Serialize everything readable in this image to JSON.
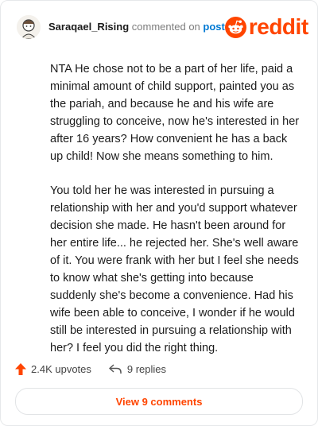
{
  "comment": {
    "username": "Saraqael_Rising",
    "action_text": "commented on",
    "post_link": "post",
    "paragraphs": [
      "NTA He chose not to be a part of her life, paid a minimal amount of child support, painted you as the pariah, and because he and his wife are struggling to conceive, now he's interested in her after 16 years? How convenient he has a back up child! Now she means something to him.",
      "You told her he was interested in pursuing a relationship with her and you'd support whatever decision she made. He hasn't been around for her entire life... he rejected her. She's well aware of it. You were frank with her but I feel she needs to know what she's getting into because suddenly she's become a convenience. Had his wife been able to conceive, I wonder if he would still be interested in pursuing a relationship with her? I feel you did the right thing."
    ]
  },
  "brand": {
    "wordmark": "reddit",
    "color": "#ff4500"
  },
  "footer": {
    "upvotes": "2.4K upvotes",
    "replies": "9 replies",
    "view_comments": "View 9 comments"
  },
  "icons": {
    "avatar": "avatar-icon",
    "logo": "reddit-snoo-icon",
    "upvote": "upvote-arrow-icon",
    "reply": "reply-arrow-icon"
  }
}
